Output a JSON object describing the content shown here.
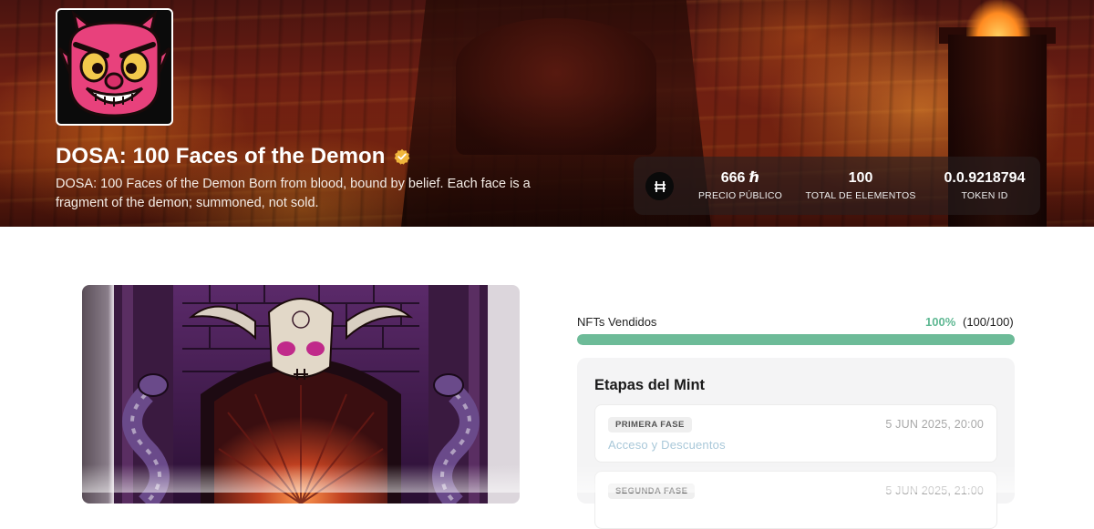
{
  "collection": {
    "title": "DOSA: 100 Faces of the Demon",
    "verified": true,
    "description": "DOSA: 100 Faces of the Demon Born from blood, bound by belief. Each face is a fragment of the demon; summoned, not sold."
  },
  "stats": {
    "currency_icon": "hbar-icon",
    "price_value": "666 ℏ",
    "price_label": "PRECIO PÚBLICO",
    "total_value": "100",
    "total_label": "TOTAL DE ELEMENTOS",
    "token_value": "0.0.9218794",
    "token_label": "TOKEN ID"
  },
  "progress": {
    "label": "NFTs Vendidos",
    "percent_text": "100%",
    "count_text": "(100/100)",
    "fraction": 1.0
  },
  "mint_stages": {
    "title": "Etapas del Mint",
    "phases": [
      {
        "badge": "PRIMERA FASE",
        "date": "5 JUN 2025, 20:00",
        "subtitle": "Acceso y Descuentos"
      },
      {
        "badge": "SEGUNDA FASE",
        "date": "5 JUN 2025, 21:00",
        "subtitle": ""
      }
    ]
  },
  "colors": {
    "accent_green": "#6dbb98",
    "percent_green": "#5fb893",
    "avatar_pink": "#e8417c",
    "avatar_yellow": "#f2c94c"
  }
}
